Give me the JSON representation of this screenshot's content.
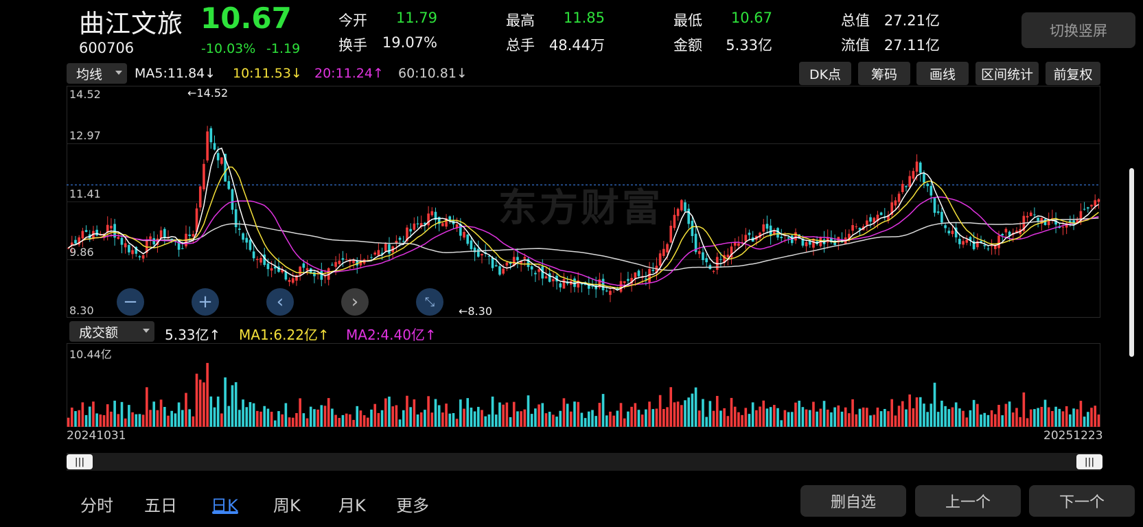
{
  "header": {
    "name": "曲江文旅",
    "code": "600706",
    "price": "10.67",
    "change_pct": "-10.03%",
    "change_abs": "-1.19",
    "quotes": [
      {
        "label": "今开",
        "value": "11.79",
        "color": "green"
      },
      {
        "label": "换手",
        "value": "19.07%",
        "color": "white"
      },
      {
        "label": "最高",
        "value": "11.85",
        "color": "green"
      },
      {
        "label": "总手",
        "value": "48.44万",
        "color": "white"
      },
      {
        "label": "最低",
        "value": "10.67",
        "color": "green"
      },
      {
        "label": "金额",
        "value": "5.33亿",
        "color": "white"
      },
      {
        "label": "总值",
        "value": "27.21亿",
        "color": "white"
      },
      {
        "label": "流值",
        "value": "27.11亿",
        "color": "white"
      }
    ],
    "rotate_button": "切换竖屏"
  },
  "ma_bar": {
    "dropdown": "均线",
    "ma5": "MA5:11.84↓",
    "ma10": "10:11.53↓",
    "ma20": "20:11.24↑",
    "ma60": "60:10.81↓",
    "tools": [
      "DK点",
      "筹码",
      "画线",
      "区间统计",
      "前复权"
    ]
  },
  "price_chart": {
    "ticks": [
      "14.52",
      "12.97",
      "11.41",
      "9.86",
      "8.30"
    ],
    "max_marker": "←14.52",
    "min_marker": "←8.30",
    "watermark": "东方财富"
  },
  "volume_bar": {
    "dropdown": "成交额",
    "value": "5.33亿↑",
    "ma1": "MA1:6.22亿↑",
    "ma2": "MA2:4.40亿↑",
    "max_tick": "10.44亿"
  },
  "dates": {
    "start": "20241031",
    "end": "20251223"
  },
  "bottom_tabs": [
    "分时",
    "五日",
    "日K",
    "周K",
    "月K",
    "更多"
  ],
  "bottom_buttons": [
    "删自选",
    "上一个",
    "下一个"
  ],
  "colors": {
    "up": "#f23a3a",
    "down": "#33d1d6",
    "ma5": "#ffffff",
    "ma10": "#f5e13a",
    "ma20": "#e033e0",
    "ma60": "#d9d9d9",
    "price_green": "#2ee23b",
    "active_tab": "#3e86f5"
  },
  "chart_data": {
    "type": "candlestick",
    "y_range": [
      8.3,
      14.52
    ],
    "close_path_approx": [
      10.1,
      10.6,
      10.4,
      10.7,
      10.2,
      9.9,
      10.3,
      10.5,
      10.1,
      10.6,
      13.3,
      12.5,
      10.8,
      10.0,
      9.8,
      9.4,
      9.2,
      9.6,
      9.3,
      9.5,
      9.7,
      9.8,
      9.9,
      10.1,
      10.4,
      10.7,
      11.0,
      10.9,
      10.6,
      10.2,
      9.8,
      9.5,
      9.9,
      9.7,
      9.4,
      9.2,
      9.1,
      9.0,
      9.1,
      9.0,
      9.2,
      9.3,
      9.4,
      10.2,
      11.5,
      10.0,
      9.5,
      9.8,
      10.2,
      10.4,
      10.6,
      10.5,
      10.4,
      10.3,
      10.3,
      10.2,
      10.5,
      10.8,
      11.0,
      11.2,
      11.8,
      12.6,
      11.4,
      10.7,
      10.3,
      10.1,
      10.2,
      10.4,
      10.6,
      11.0,
      10.9,
      10.7,
      10.8,
      11.1,
      11.5
    ]
  }
}
